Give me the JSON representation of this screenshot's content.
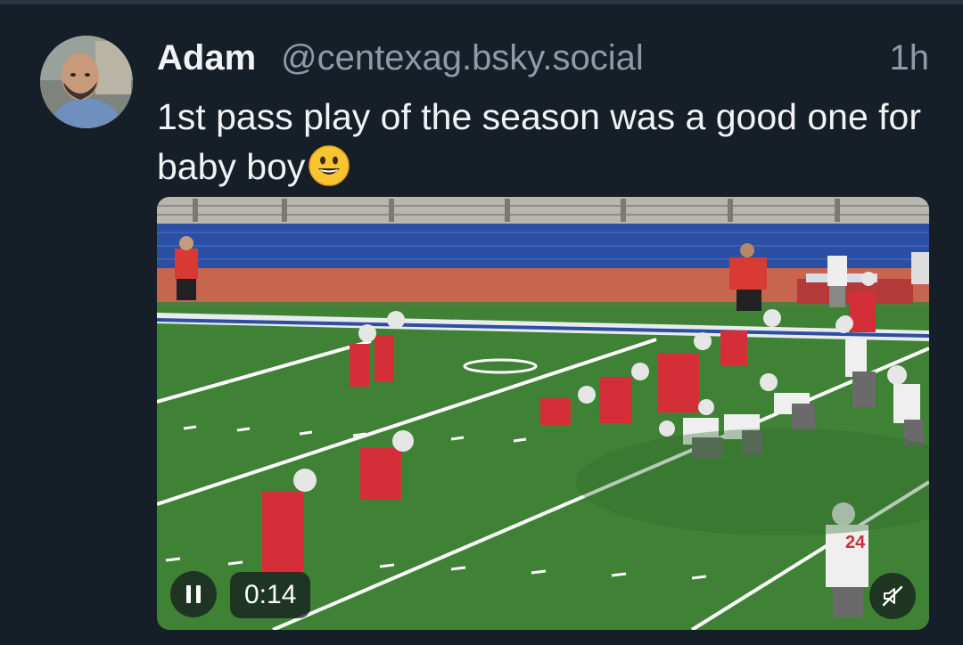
{
  "post": {
    "author_name": "Adam",
    "handle": "@centexag.bsky.social",
    "timestamp": "1h",
    "text": "1st pass play of the season was a good one for baby boy",
    "emoji": "grinning-face-icon"
  },
  "video": {
    "time": "0:14",
    "state": "playing",
    "muted": true,
    "icons": {
      "pause": "pause-icon",
      "mute": "speaker-muted-icon"
    },
    "jersey_number": "24"
  },
  "colors": {
    "background": "#161e27",
    "name": "#f1f3f5",
    "secondary": "#8d9ba8"
  }
}
